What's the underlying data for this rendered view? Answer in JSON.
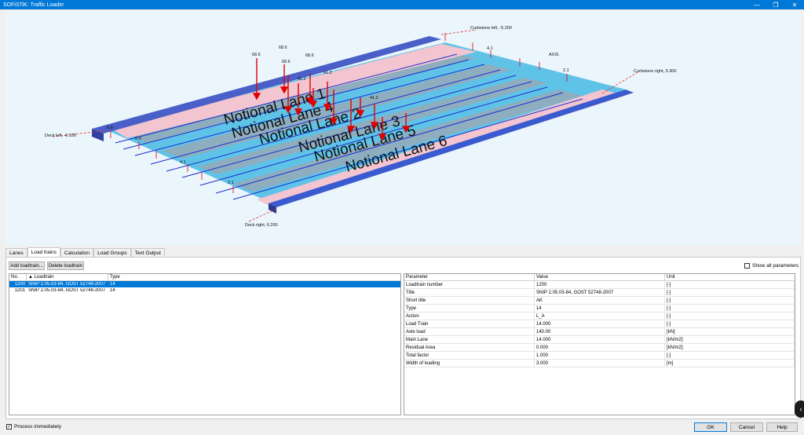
{
  "window": {
    "title": "SOFiSTiK: Traffic Loader",
    "minimize": "—",
    "restore": "❐",
    "close": "✕"
  },
  "viewport": {
    "lane_labels": [
      "Notional Lane 1",
      "Notional Lane 2",
      "Notional Lane 3",
      "Notional Lane 4",
      "Notional Lane 5",
      "Notional Lane 6"
    ],
    "edge_labels": {
      "curbstone_left": "Curbstone left, -5.200",
      "curbstone_right": "Curbstone right, 5.300",
      "deck_left": "Deck left, -6.100",
      "deck_right": "Deck right, 6.200",
      "axis": "AXIS"
    },
    "load_values_top": [
      "68.6",
      "68.6",
      "68.6",
      "68.6",
      "41.2",
      "41.2",
      "41.2"
    ],
    "load_values_edge": [
      "6.9",
      "6.9",
      "4.1",
      "4.1",
      "2.1",
      "2.1"
    ]
  },
  "tabs": [
    {
      "label": "Lanes",
      "active": false
    },
    {
      "label": "Load trains",
      "active": true
    },
    {
      "label": "Calculation",
      "active": false
    },
    {
      "label": "Load Groups",
      "active": false
    },
    {
      "label": "Text Output",
      "active": false
    }
  ],
  "toolbar": {
    "add_label": "Add loadtrain...",
    "delete_label": "Delete loadtrain",
    "show_all_label": "Show all parameters"
  },
  "loadtrains": {
    "headers": [
      "No.",
      "Loadtrain",
      "Type"
    ],
    "rows": [
      {
        "no": "1200",
        "name": "SNIP 2.05.03-84, GOST 52748-2007",
        "type": "14"
      },
      {
        "no": "1201",
        "name": "SNIP 2.05.03-84, GOST 52748-2007",
        "type": "14"
      }
    ]
  },
  "params": {
    "headers": [
      "Parameter",
      "Value",
      "Unit"
    ],
    "rows": [
      {
        "p": "Loadtrain number",
        "v": "1200",
        "u": "[-]"
      },
      {
        "p": "Title",
        "v": "SNIP 2.05.03-84, GOST 52748-2007",
        "u": "[-]"
      },
      {
        "p": "Short title",
        "v": "AK",
        "u": "[-]"
      },
      {
        "p": "Type",
        "v": "14",
        "u": "[-]"
      },
      {
        "p": "Action",
        "v": "L_A",
        "u": "[-]"
      },
      {
        "p": "Load Train",
        "v": "14.000",
        "u": "[-]"
      },
      {
        "p": "Axle load",
        "v": "140.00",
        "u": "[kN]"
      },
      {
        "p": "Main Lane",
        "v": "14.000",
        "u": "[kN/m2]"
      },
      {
        "p": "Residual Area",
        "v": "0.000",
        "u": "[kN/m2]"
      },
      {
        "p": "Total factor",
        "v": "1.000",
        "u": "[-]"
      },
      {
        "p": "Width of loading",
        "v": "3.000",
        "u": "[m]"
      }
    ]
  },
  "footer": {
    "process_label": "Process immediately",
    "ok": "OK",
    "cancel": "Cancel",
    "help": "Help"
  }
}
